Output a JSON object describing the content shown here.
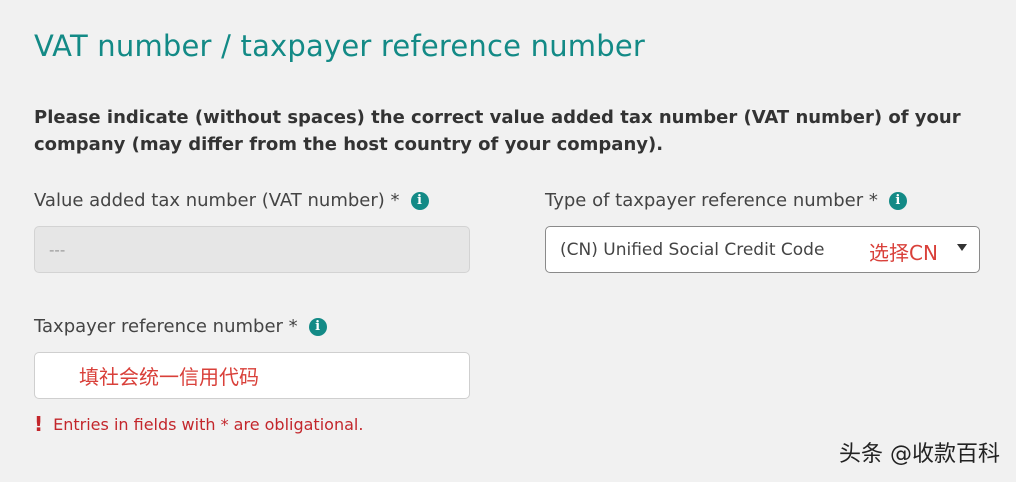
{
  "section": {
    "title": "VAT number / taxpayer reference number",
    "intro": "Please indicate (without spaces) the correct value added tax number (VAT number) of your company (may differ from the host country of your company)."
  },
  "vat_field": {
    "label": "Value added tax number (VAT number) *",
    "value": "---"
  },
  "type_field": {
    "label": "Type of taxpayer reference number *",
    "selected": "(CN) Unified Social Credit Code",
    "annotation": "选择CN"
  },
  "taxpayer_field": {
    "label": "Taxpayer reference number *",
    "annotation": "填社会统一信用代码"
  },
  "validation": {
    "icon": "!",
    "message": "Entries in fields with * are obligational."
  },
  "watermark": "头条 @收款百科",
  "info_icon_glyph": "i",
  "colors": {
    "accent": "#138a86",
    "annotation": "#d9403a",
    "error": "#c3262b"
  },
  "icons": [
    "info-icon",
    "dropdown-caret-icon",
    "exclamation-icon"
  ]
}
